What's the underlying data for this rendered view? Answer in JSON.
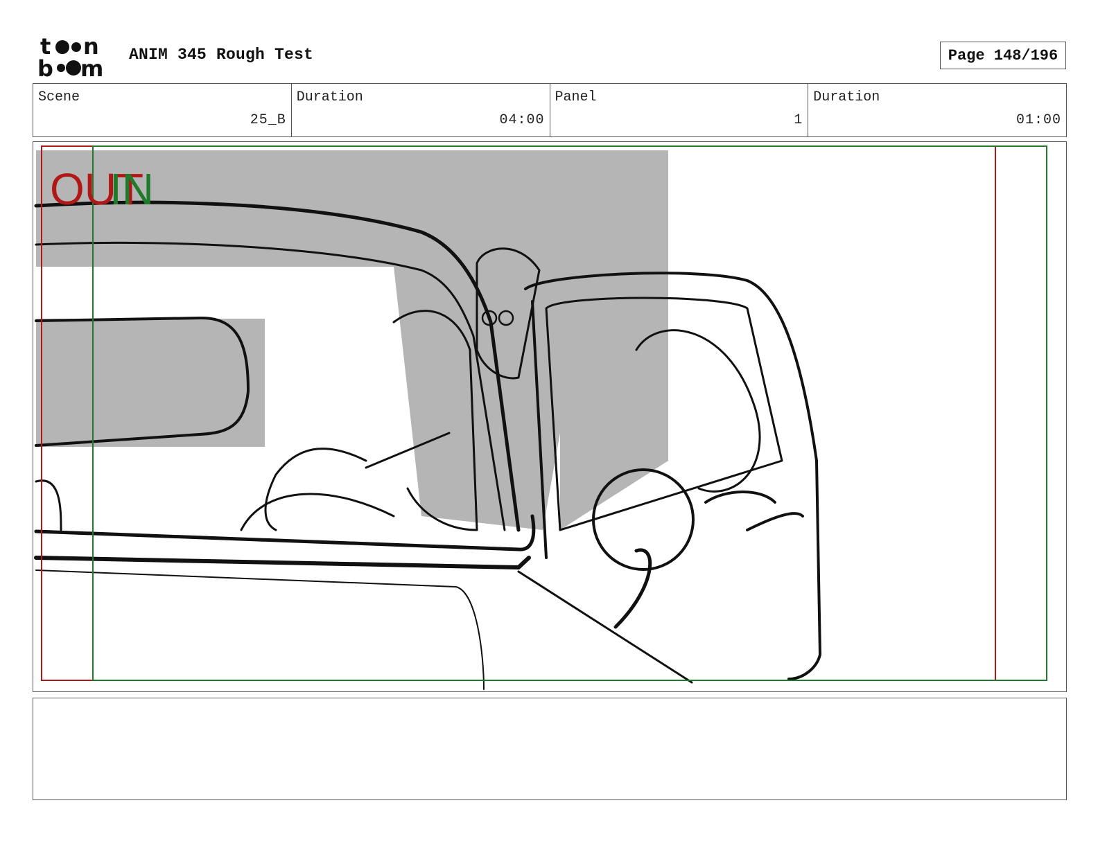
{
  "header": {
    "logo_lines": [
      "toon",
      "boom"
    ],
    "project_title": "ANIM 345 Rough Test",
    "page": "Page 148/196"
  },
  "info": [
    {
      "label": "Scene",
      "value": "25_B"
    },
    {
      "label": "Duration",
      "value": "04:00"
    },
    {
      "label": "Panel",
      "value": "1"
    },
    {
      "label": "Duration",
      "value": "01:00"
    }
  ],
  "panel": {
    "overlay_out": "OUT",
    "overlay_in": "IN",
    "colors": {
      "out_frame": "#b01818",
      "in_frame": "#1f7a2a",
      "shadow": "#b5b5b5"
    }
  },
  "notes": {
    "text": ""
  }
}
